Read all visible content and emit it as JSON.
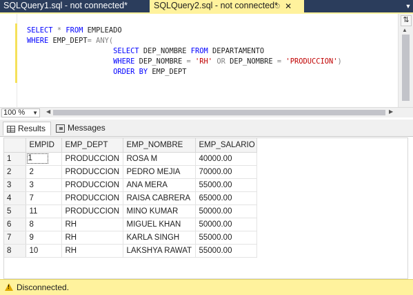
{
  "tabs": [
    {
      "title": "SQLQuery1.sql - not connected*",
      "active": false
    },
    {
      "title": "SQLQuery2.sql - not connected*",
      "active": true
    }
  ],
  "tab_icons": {
    "pin": "pin-icon",
    "close": "close-icon"
  },
  "editor": {
    "lines": [
      [
        {
          "t": "SELECT",
          "c": "kw"
        },
        {
          "t": " ",
          "c": ""
        },
        {
          "t": "*",
          "c": "op"
        },
        {
          "t": " ",
          "c": ""
        },
        {
          "t": "FROM",
          "c": "kw"
        },
        {
          "t": " EMPLEADO",
          "c": ""
        }
      ],
      [
        {
          "t": "WHERE",
          "c": "kw"
        },
        {
          "t": " EMP_DEPT",
          "c": ""
        },
        {
          "t": "=",
          "c": "op"
        },
        {
          "t": " ",
          "c": ""
        },
        {
          "t": "ANY(",
          "c": "op"
        }
      ],
      [
        {
          "t": "                    ",
          "c": ""
        },
        {
          "t": "SELECT",
          "c": "kw"
        },
        {
          "t": " DEP_NOMBRE ",
          "c": ""
        },
        {
          "t": "FROM",
          "c": "kw"
        },
        {
          "t": " DEPARTAMENTO",
          "c": ""
        }
      ],
      [
        {
          "t": "                    ",
          "c": ""
        },
        {
          "t": "WHERE",
          "c": "kw"
        },
        {
          "t": " DEP_NOMBRE ",
          "c": ""
        },
        {
          "t": "=",
          "c": "op"
        },
        {
          "t": " ",
          "c": ""
        },
        {
          "t": "'RH'",
          "c": "str"
        },
        {
          "t": " ",
          "c": ""
        },
        {
          "t": "OR",
          "c": "op"
        },
        {
          "t": " DEP_NOMBRE ",
          "c": ""
        },
        {
          "t": "=",
          "c": "op"
        },
        {
          "t": " ",
          "c": ""
        },
        {
          "t": "'PRODUCCION'",
          "c": "str"
        },
        {
          "t": ")",
          "c": "op"
        }
      ],
      [
        {
          "t": "                    ",
          "c": ""
        },
        {
          "t": "ORDER BY",
          "c": "kw"
        },
        {
          "t": " EMP_DEPT",
          "c": ""
        }
      ]
    ]
  },
  "zoom": {
    "value": "100 %"
  },
  "result_tabs": [
    {
      "label": "Results",
      "icon": "grid-icon"
    },
    {
      "label": "Messages",
      "icon": "messages-icon"
    }
  ],
  "grid": {
    "columns": [
      "",
      "EMPID",
      "EMP_DEPT",
      "EMP_NOMBRE",
      "EMP_SALARIO"
    ],
    "rows": [
      [
        "1",
        "1",
        "PRODUCCION",
        "ROSA M",
        "40000.00"
      ],
      [
        "2",
        "2",
        "PRODUCCION",
        "PEDRO MEJIA",
        "70000.00"
      ],
      [
        "3",
        "3",
        "PRODUCCION",
        "ANA MERA",
        "55000.00"
      ],
      [
        "4",
        "7",
        "PRODUCCION",
        "RAISA CABRERA",
        "65000.00"
      ],
      [
        "5",
        "11",
        "PRODUCCION",
        "MINO KUMAR",
        "50000.00"
      ],
      [
        "6",
        "8",
        "RH",
        "MIGUEL KHAN",
        "50000.00"
      ],
      [
        "7",
        "9",
        "RH",
        "KARLA SINGH",
        "55000.00"
      ],
      [
        "8",
        "10",
        "RH",
        "LAKSHYA RAWAT",
        "55000.00"
      ]
    ]
  },
  "status": {
    "text": "Disconnected.",
    "icon": "warning-icon"
  },
  "colors": {
    "active_tab": "#fff29d",
    "tab_strip": "#2b3d5c",
    "keyword": "#0000ff",
    "string": "#c00000",
    "operator": "#808080"
  }
}
